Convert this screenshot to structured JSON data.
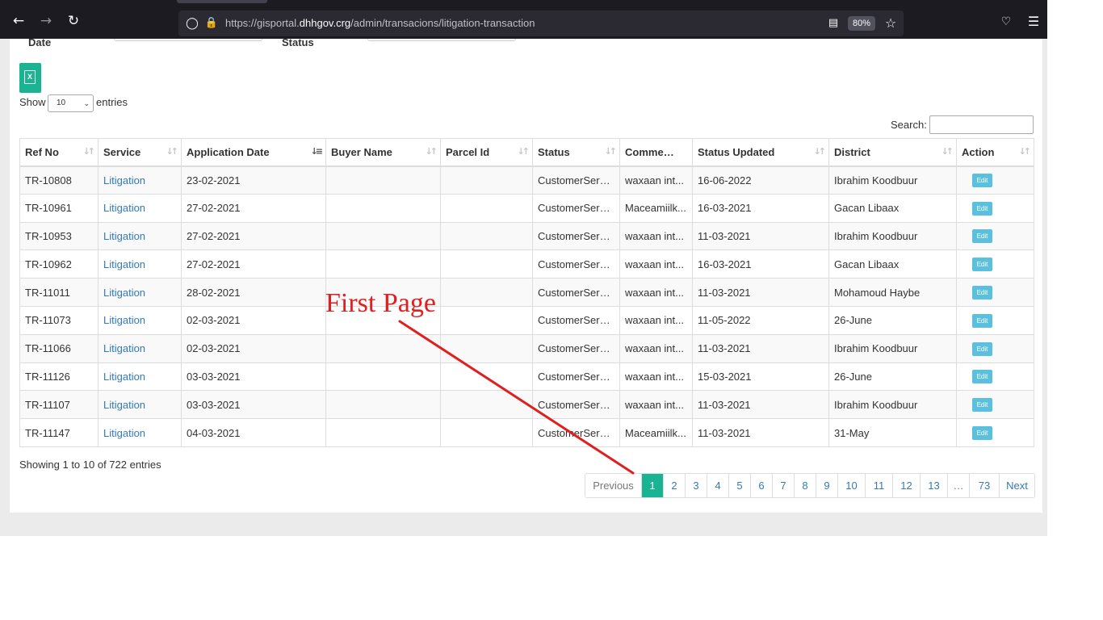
{
  "browser": {
    "url_prefix": "https://gisportal.",
    "url_host": "dhhgov.crg",
    "url_path": "/admin/transacions/litigation-transaction",
    "zoom": "80%",
    "icons": {
      "back": "arrow-left-icon",
      "forward": "arrow-right-icon",
      "reload": "reload-icon",
      "shield": "shield-icon",
      "lock": "lock-icon",
      "reader": "reader-view-icon",
      "bookmark": "star-icon",
      "pocket": "pocket-icon",
      "menu": "hamburger-menu-icon"
    }
  },
  "filters": {
    "date_label": "Date",
    "status_label": "Status"
  },
  "export": {
    "icon": "excel-icon",
    "glyph": "X"
  },
  "length": {
    "show": "Show",
    "value": "10",
    "entries": "entries"
  },
  "search": {
    "label": "Search:",
    "value": ""
  },
  "table": {
    "columns": [
      "Ref No",
      "Service",
      "Application Date",
      "Buyer Name",
      "Parcel Id",
      "Status",
      "Comments",
      "Status Updated",
      "District",
      "Action"
    ],
    "sorted_column": "Application Date",
    "rows": [
      {
        "ref": "TR-10808",
        "service": "Litigation",
        "app_date": "23-02-2021",
        "buyer": "",
        "parcel": "",
        "status": "CustomerServi...",
        "comments": "waxaan int...",
        "updated": "16-06-2022",
        "district": "Ibrahim Koodbuur",
        "action": "Edit"
      },
      {
        "ref": "TR-10961",
        "service": "Litigation",
        "app_date": "27-02-2021",
        "buyer": "",
        "parcel": "",
        "status": "CustomerServi...",
        "comments": "Maceamiilk...",
        "updated": "16-03-2021",
        "district": "Gacan Libaax",
        "action": "Edit"
      },
      {
        "ref": "TR-10953",
        "service": "Litigation",
        "app_date": "27-02-2021",
        "buyer": "",
        "parcel": "",
        "status": "CustomerServi...",
        "comments": "waxaan int...",
        "updated": "11-03-2021",
        "district": "Ibrahim Koodbuur",
        "action": "Edit"
      },
      {
        "ref": "TR-10962",
        "service": "Litigation",
        "app_date": "27-02-2021",
        "buyer": "",
        "parcel": "",
        "status": "CustomerServi...",
        "comments": "waxaan int...",
        "updated": "16-03-2021",
        "district": "Gacan Libaax",
        "action": "Edit"
      },
      {
        "ref": "TR-11011",
        "service": "Litigation",
        "app_date": "28-02-2021",
        "buyer": "",
        "parcel": "",
        "status": "CustomerServi...",
        "comments": "waxaan int...",
        "updated": "11-03-2021",
        "district": "Mohamoud Haybe",
        "action": "Edit"
      },
      {
        "ref": "TR-11073",
        "service": "Litigation",
        "app_date": "02-03-2021",
        "buyer": "",
        "parcel": "",
        "status": "CustomerServi...",
        "comments": "waxaan int...",
        "updated": "11-05-2022",
        "district": "26-June",
        "action": "Edit"
      },
      {
        "ref": "TR-11066",
        "service": "Litigation",
        "app_date": "02-03-2021",
        "buyer": "",
        "parcel": "",
        "status": "CustomerServi...",
        "comments": "waxaan int...",
        "updated": "11-03-2021",
        "district": "Ibrahim Koodbuur",
        "action": "Edit"
      },
      {
        "ref": "TR-11126",
        "service": "Litigation",
        "app_date": "03-03-2021",
        "buyer": "",
        "parcel": "",
        "status": "CustomerServi...",
        "comments": "waxaan int...",
        "updated": "15-03-2021",
        "district": "26-June",
        "action": "Edit"
      },
      {
        "ref": "TR-11107",
        "service": "Litigation",
        "app_date": "03-03-2021",
        "buyer": "",
        "parcel": "",
        "status": "CustomerServi...",
        "comments": "waxaan int...",
        "updated": "11-03-2021",
        "district": "Ibrahim Koodbuur",
        "action": "Edit"
      },
      {
        "ref": "TR-11147",
        "service": "Litigation",
        "app_date": "04-03-2021",
        "buyer": "",
        "parcel": "",
        "status": "CustomerServi...",
        "comments": "Maceamiilk...",
        "updated": "11-03-2021",
        "district": "31-May",
        "action": "Edit"
      }
    ]
  },
  "info": "Showing 1 to 10 of 722 entries",
  "pagination": {
    "previous": "Previous",
    "pages": [
      "1",
      "2",
      "3",
      "4",
      "5",
      "6",
      "7",
      "8",
      "9",
      "10",
      "11",
      "12",
      "13",
      "…",
      "73"
    ],
    "current": "1",
    "next": "Next"
  },
  "annotation": {
    "text": "First Page",
    "color": "#e02020"
  },
  "colors": {
    "accent": "#1ab394",
    "link": "#337ab7",
    "edit": "#5bc0de",
    "chrome": "#1c1b22"
  }
}
